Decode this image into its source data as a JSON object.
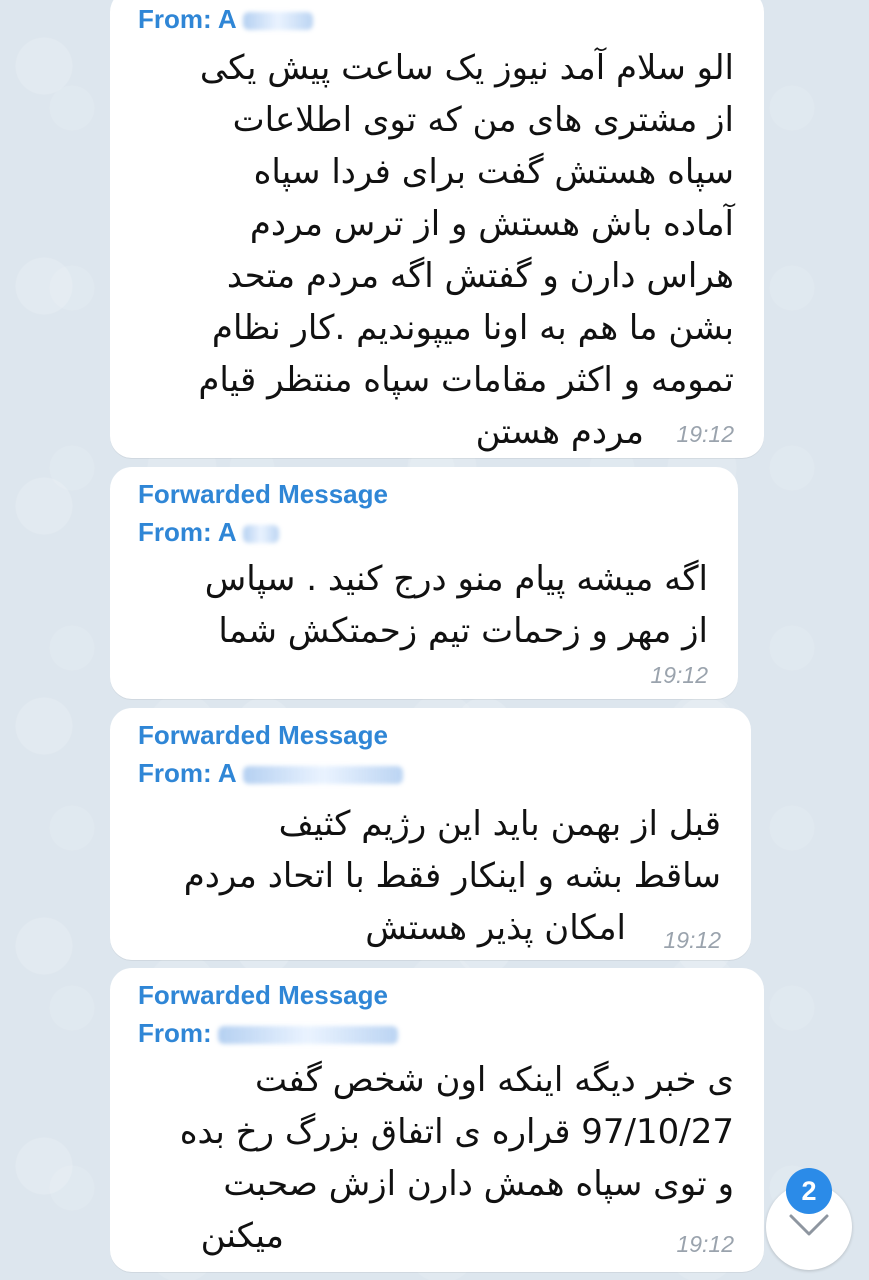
{
  "messages": [
    {
      "from_label": "From: A",
      "lines": [
        "الو سلام آمد نیوز یک ساعت پیش یکی",
        "از مشتری های من که توی اطلاعات",
        "سپاه هستش گفت برای فردا سپاه",
        "آماده باش هستش و از ترس مردم",
        "هراس دارن و گفتش اگه مردم متحد",
        "بشن ما هم به اونا میپوندیم .کار نظام",
        "تمومه و اکثر مقامات سپاه منتظر قیام",
        "مردم هستن"
      ],
      "time": "19:12"
    },
    {
      "forward_label": "Forwarded Message",
      "from_label": "From: A",
      "lines": [
        "اگه میشه پیام منو درج کنید . سپاس",
        "از مهر و زحمات تیم زحمتکش شما"
      ],
      "time": "19:12"
    },
    {
      "forward_label": "Forwarded Message",
      "from_label": "From: A",
      "lines": [
        "قبل از بهمن باید این رژیم کثیف",
        "ساقط بشه و اینکار فقط با اتحاد مردم",
        "امکان پذیر هستش"
      ],
      "time": "19:12"
    },
    {
      "forward_label": "Forwarded Message",
      "from_label": "From:",
      "lines": [
        "ی خبر دیگه اینکه اون شخص گفت",
        "97/10/27 قراره ی اتفاق بزرگ رخ بده",
        "و توی سپاه همش دارن ازش صحبت",
        "میکنن"
      ],
      "time": "19:12"
    }
  ],
  "scroll_down": {
    "unread_count": "2",
    "icon": "chevron-down-icon"
  },
  "colors": {
    "accent": "#2f86d6",
    "badge": "#2b8be8",
    "bubble": "#ffffff",
    "background": "#dde6ee",
    "time": "#9aa3ad"
  }
}
